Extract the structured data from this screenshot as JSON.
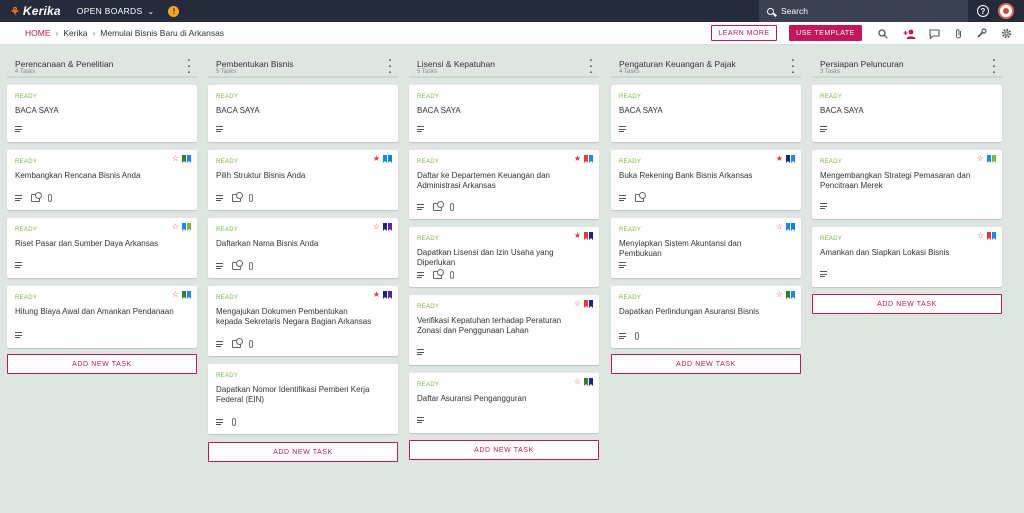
{
  "app": {
    "logo": "Kerika",
    "open_boards": "OPEN BOARDS",
    "search_label": "Search",
    "help": "?"
  },
  "breadcrumb": {
    "home": "HOME",
    "org": "Kerika",
    "board": "Memulai Bisnis Baru di Arkansas"
  },
  "toolbar": {
    "learn_more": "LEARN MORE",
    "use_template": "USE TEMPLATE"
  },
  "colors": {
    "red": "#e53935",
    "blue": "#1e88e5",
    "green": "#2e7d32",
    "lightgreen": "#7cb342",
    "navy": "#1a237e",
    "purple": "#6a1b9a",
    "teal": "#0288d1",
    "accent": "#c2185b"
  },
  "add_task_label": "ADD NEW TASK",
  "columns": [
    {
      "title": "Perencanaan & Penelitian",
      "count": "4 Tasks",
      "cards": [
        {
          "status": "READY",
          "title": "BACA SAYA",
          "star": "",
          "flags": [],
          "icons": [
            "lines"
          ]
        },
        {
          "status": "READY",
          "title": "Kembangkan Rencana Bisnis Anda",
          "star": "outline",
          "flags": [
            "#2e7d32",
            "#1e88e5"
          ],
          "icons": [
            "lines",
            "check",
            "clip"
          ]
        },
        {
          "status": "READY",
          "title": "Riset Pasar dan Sumber Daya Arkansas",
          "star": "outline",
          "flags": [
            "#1e88e5",
            "#7cb342"
          ],
          "icons": [
            "lines"
          ]
        },
        {
          "status": "READY",
          "title": "Hitung Biaya Awal dan Amankan Pendanaan",
          "star": "outline",
          "flags": [
            "#2e7d32",
            "#1e88e5"
          ],
          "icons": [
            "lines"
          ]
        }
      ]
    },
    {
      "title": "Pembentukan Bisnis",
      "count": "5 Tasks",
      "cards": [
        {
          "status": "READY",
          "title": "BACA SAYA",
          "star": "",
          "flags": [],
          "icons": [
            "lines"
          ]
        },
        {
          "status": "READY",
          "title": "Pilih Struktur Bisnis Anda",
          "star": "filled",
          "flags": [
            "#1e88e5",
            "#0288d1"
          ],
          "icons": [
            "lines",
            "check",
            "clip"
          ]
        },
        {
          "status": "READY",
          "title": "Daftarkan Nama Bisnis Anda",
          "star": "outline",
          "flags": [
            "#1a237e",
            "#6a1b9a"
          ],
          "icons": [
            "lines",
            "check",
            "clip"
          ]
        },
        {
          "status": "READY",
          "title": "Mengajukan Dokumen Pembentukan kepada Sekretaris Negara Bagian Arkansas",
          "star": "filled",
          "flags": [
            "#1a237e",
            "#6a1b9a"
          ],
          "icons": [
            "lines",
            "check",
            "clip"
          ]
        },
        {
          "status": "READY",
          "title": "Dapatkan Nomor Identifikasi Pemberi Kerja Federal (EIN)",
          "star": "",
          "flags": [],
          "icons": [
            "lines",
            "clip"
          ]
        }
      ]
    },
    {
      "title": "Lisensi & Kepatuhan",
      "count": "5 Tasks",
      "cards": [
        {
          "status": "READY",
          "title": "BACA SAYA",
          "star": "",
          "flags": [],
          "icons": [
            "lines"
          ]
        },
        {
          "status": "READY",
          "title": "Daftar ke Departemen Keuangan dan Administrasi Arkansas",
          "star": "filled",
          "flags": [
            "#e53935",
            "#1e88e5"
          ],
          "icons": [
            "lines",
            "check",
            "clip"
          ]
        },
        {
          "status": "READY",
          "title": "Dapatkan Lisensi dan Izin Usaha yang Diperlukan",
          "star": "filled",
          "flags": [
            "#e53935",
            "#1a237e"
          ],
          "icons": [
            "lines",
            "check",
            "clip"
          ]
        },
        {
          "status": "READY",
          "title": "Verifikasi Kepatuhan terhadap Peraturan Zonasi dan Penggunaan Lahan",
          "star": "outline",
          "flags": [
            "#e53935",
            "#1a237e"
          ],
          "icons": [
            "lines"
          ]
        },
        {
          "status": "READY",
          "title": "Daftar Asuransi Pengangguran",
          "star": "outline",
          "flags": [
            "#2e7d32",
            "#1a237e"
          ],
          "icons": [
            "lines"
          ]
        }
      ]
    },
    {
      "title": "Pengaturan Keuangan & Pajak",
      "count": "4 Tasks",
      "cards": [
        {
          "status": "READY",
          "title": "BACA SAYA",
          "star": "",
          "flags": [],
          "icons": [
            "lines"
          ]
        },
        {
          "status": "READY",
          "title": "Buka Rekening Bank Bisnis Arkansas",
          "star": "filled",
          "flags": [
            "#1a237e",
            "#1e88e5"
          ],
          "icons": [
            "lines",
            "check"
          ]
        },
        {
          "status": "READY",
          "title": "Menyiapkan Sistem Akuntansi dan Pembukuan",
          "star": "outline",
          "flags": [
            "#1e88e5",
            "#0288d1"
          ],
          "icons": [
            "lines"
          ]
        },
        {
          "status": "READY",
          "title": "Dapatkan Perlindungan Asuransi Bisnis",
          "star": "outline",
          "flags": [
            "#2e7d32",
            "#1e88e5"
          ],
          "icons": [
            "lines",
            "clip"
          ]
        }
      ]
    },
    {
      "title": "Persiapan Peluncuran",
      "count": "3 Tasks",
      "cards": [
        {
          "status": "READY",
          "title": "BACA SAYA",
          "star": "",
          "flags": [],
          "icons": [
            "lines"
          ]
        },
        {
          "status": "READY",
          "title": "Mengembangkan Strategi Pemasaran dan Pencitraan Merek",
          "star": "outline",
          "flags": [
            "#1e88e5",
            "#7cb342"
          ],
          "icons": [
            "lines"
          ]
        },
        {
          "status": "READY",
          "title": "Amankan dan Siapkan Lokasi Bisnis",
          "star": "outline",
          "flags": [
            "#e53935",
            "#1e88e5"
          ],
          "icons": [
            "lines"
          ]
        }
      ]
    }
  ]
}
